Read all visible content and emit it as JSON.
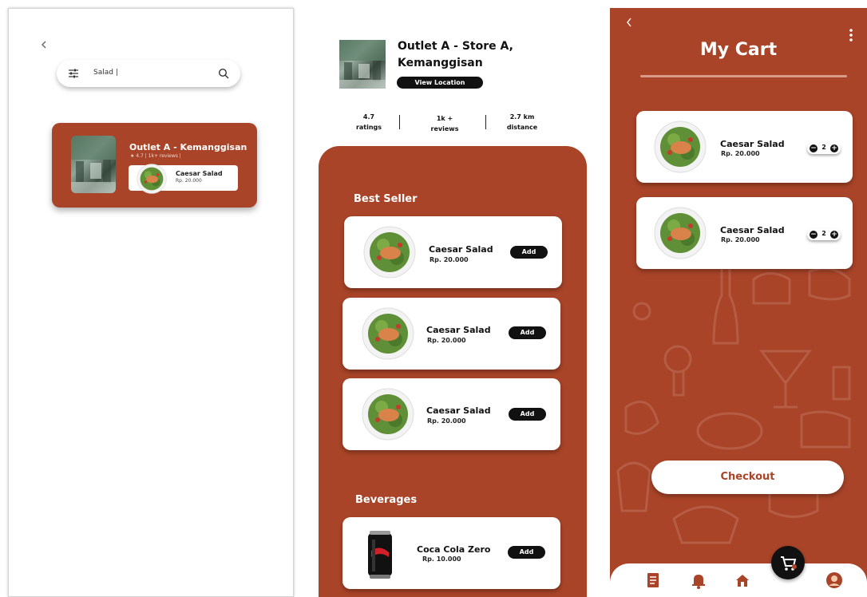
{
  "colors": {
    "brand": "#a94428",
    "dark": "#111111",
    "white": "#ffffff"
  },
  "search_screen": {
    "back_icon": "chevron-left-icon",
    "search": {
      "value": "Salad |",
      "filter_icon": "sliders-icon",
      "search_icon": "magnifier-icon"
    },
    "result": {
      "title": "Outlet A - Kemanggisan",
      "meta": "★ 4.7   |  1k+ reviews  |",
      "item": {
        "name": "Caesar Salad",
        "price": "Rp. 20.000"
      }
    }
  },
  "store_screen": {
    "store_title": "Outlet A - Store A, Kemanggisan",
    "view_location": "View Location",
    "stats": [
      {
        "value": "4.7",
        "label": "ratings"
      },
      {
        "value": "1k +",
        "label": "reviews"
      },
      {
        "value": "2.7 km",
        "label": "distance"
      }
    ],
    "sections": [
      {
        "title": "Best Seller",
        "items": [
          {
            "name": "Caesar Salad",
            "price": "Rp. 20.000",
            "action": "Add"
          },
          {
            "name": "Caesar Salad",
            "price": "Rp. 20.000",
            "action": "Add"
          },
          {
            "name": "Caesar Salad",
            "price": "Rp. 20.000",
            "action": "Add"
          }
        ]
      },
      {
        "title": "Beverages",
        "items": [
          {
            "name": "Coca Cola Zero",
            "price": "Rp. 10.000",
            "action": "Add"
          }
        ]
      }
    ]
  },
  "cart_screen": {
    "title": "My Cart",
    "back_icon": "chevron-left-icon",
    "menu_icon": "more-vertical-icon",
    "items": [
      {
        "name": "Caesar Salad",
        "price": "Rp. 20.000",
        "qty": "2",
        "minus": "−",
        "plus": "+"
      },
      {
        "name": "Caesar Salad",
        "price": "Rp. 20.000",
        "qty": "2",
        "minus": "−",
        "plus": "+"
      }
    ],
    "checkout_label": "Checkout",
    "nav": [
      "receipt-icon",
      "bell-icon",
      "home-icon",
      "cart-icon",
      "profile-icon"
    ]
  }
}
